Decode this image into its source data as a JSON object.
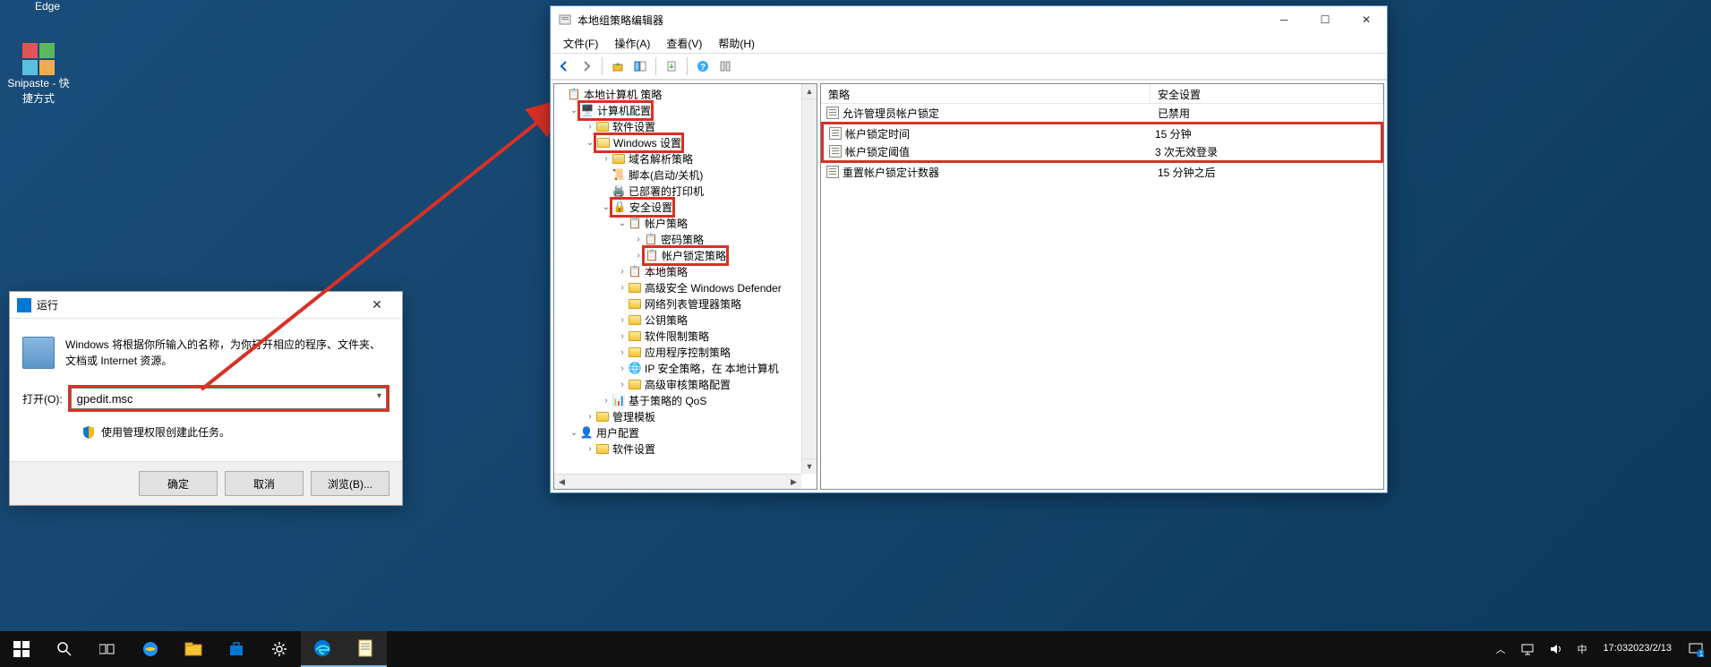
{
  "desktop": {
    "edge_label": "Edge",
    "snipaste_label": "Snipaste - 快捷方式"
  },
  "run_dialog": {
    "title": "运行",
    "description": "Windows 将根据你所输入的名称，为你打开相应的程序、文件夹、文档或 Internet 资源。",
    "open_label": "打开(O):",
    "input_value": "gpedit.msc",
    "admin_note": "使用管理权限创建此任务。",
    "ok": "确定",
    "cancel": "取消",
    "browse": "浏览(B)..."
  },
  "gpedit": {
    "title": "本地组策略编辑器",
    "menu": {
      "file": "文件(F)",
      "action": "操作(A)",
      "view": "查看(V)",
      "help": "帮助(H)"
    },
    "tree": {
      "root": "本地计算机 策略",
      "computer_config": "计算机配置",
      "software_settings": "软件设置",
      "windows_settings": "Windows 设置",
      "dns_policy": "域名解析策略",
      "scripts": "脚本(启动/关机)",
      "deployed_printers": "已部署的打印机",
      "security_settings": "安全设置",
      "account_policies": "帐户策略",
      "password_policy": "密码策略",
      "account_lockout_policy": "帐户锁定策略",
      "local_policies": "本地策略",
      "defender": "高级安全 Windows Defender",
      "network_list": "网络列表管理器策略",
      "public_key": "公钥策略",
      "software_restriction": "软件限制策略",
      "app_control": "应用程序控制策略",
      "ip_security": "IP 安全策略，在 本地计算机",
      "advanced_audit": "高级审核策略配置",
      "qos": "基于策略的 QoS",
      "admin_templates": "管理模板",
      "user_config": "用户配置",
      "software_settings2": "软件设置"
    },
    "list": {
      "col_policy": "策略",
      "col_security": "安全设置",
      "rows": [
        {
          "policy": "允许管理员帐户锁定",
          "setting": "已禁用"
        },
        {
          "policy": "帐户锁定时间",
          "setting": "15 分钟"
        },
        {
          "policy": "帐户锁定阈值",
          "setting": "3 次无效登录"
        },
        {
          "policy": "重置帐户锁定计数器",
          "setting": "15 分钟之后"
        }
      ]
    }
  },
  "taskbar": {
    "time": "17:03",
    "date": "2023/2/13",
    "ime": "中",
    "notif_count": "1"
  }
}
